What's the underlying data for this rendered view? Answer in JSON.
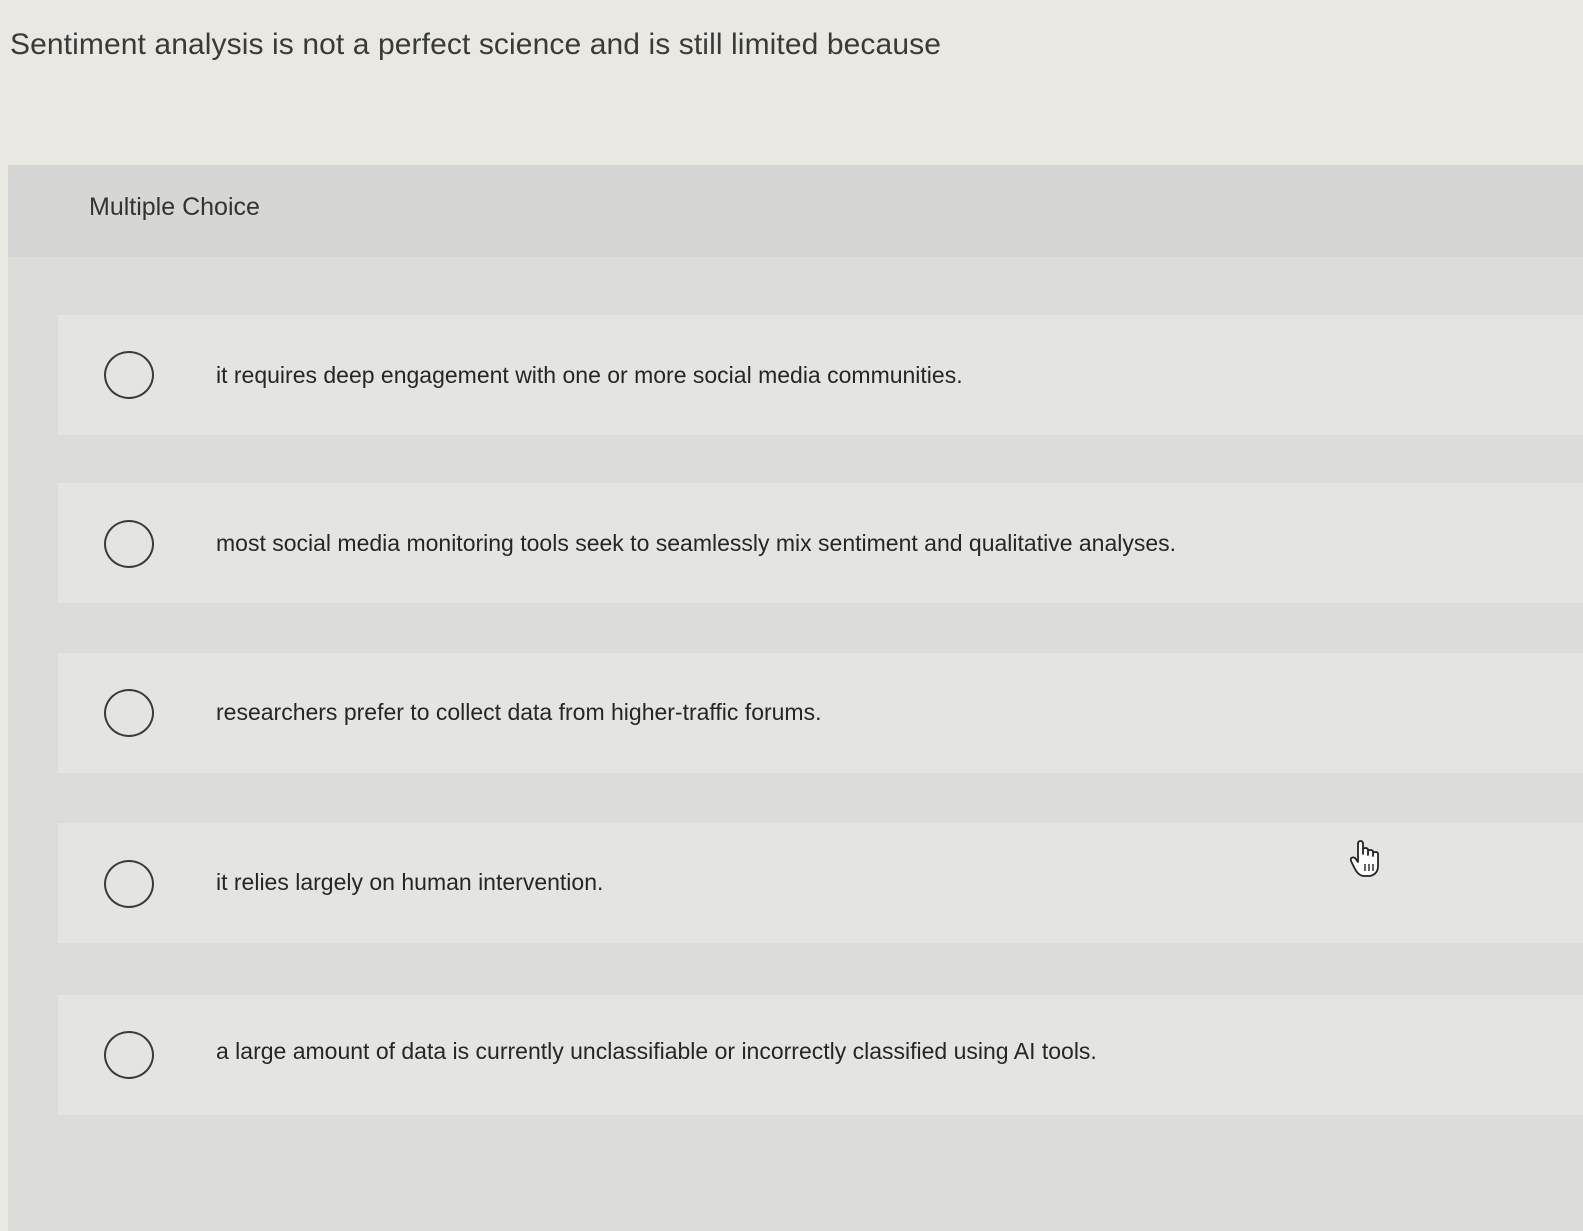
{
  "question": {
    "text": "Sentiment analysis is not a perfect science and is still limited because"
  },
  "panel": {
    "label": "Multiple Choice"
  },
  "options": [
    {
      "text": "it requires deep engagement with one or more social media communities.",
      "selected": false
    },
    {
      "text": "most social media monitoring tools seek to seamlessly mix sentiment and qualitative analyses.",
      "selected": false
    },
    {
      "text": "researchers prefer to collect data from higher-traffic forums.",
      "selected": false
    },
    {
      "text": "it relies largely on human intervention.",
      "selected": false
    },
    {
      "text": "a large amount of data is currently unclassifiable or incorrectly classified using AI tools.",
      "selected": false
    }
  ],
  "cursor": {
    "icon": "hand-pointer-icon"
  }
}
